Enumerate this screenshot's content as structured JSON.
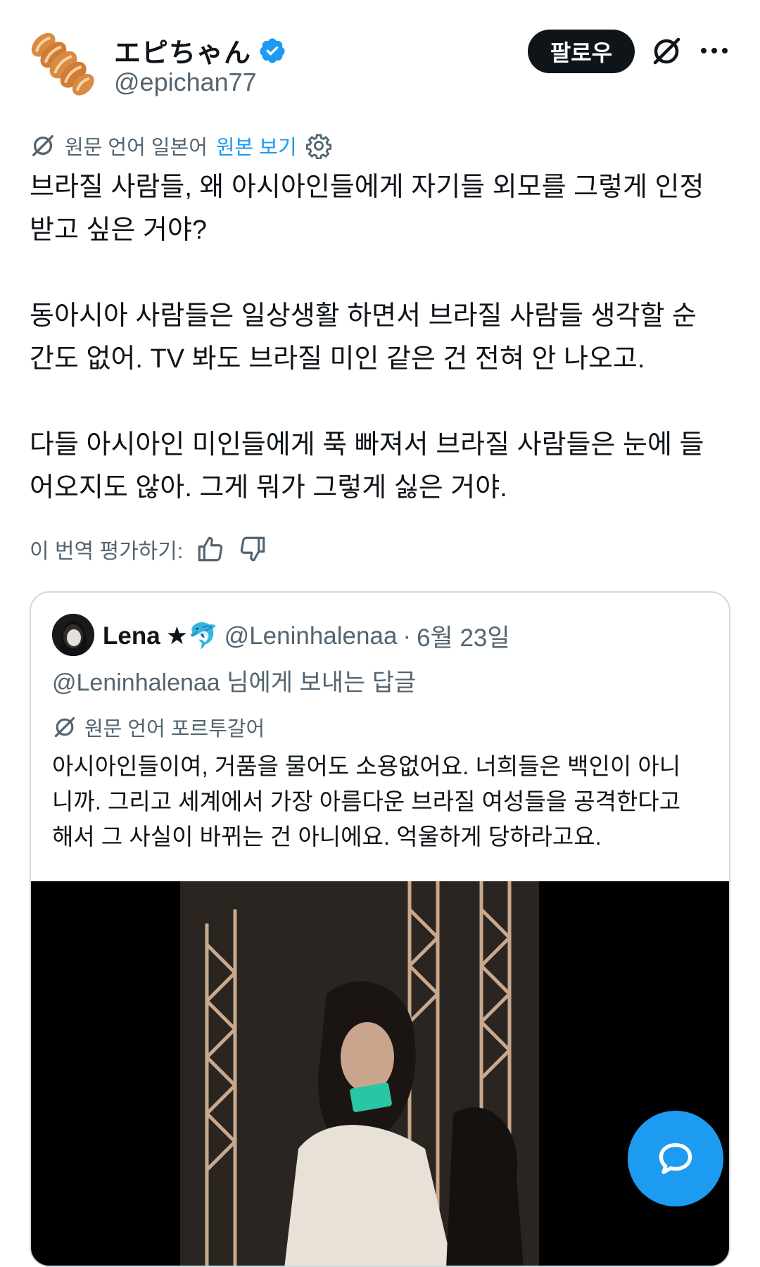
{
  "author": {
    "display_name": "エピちゃん",
    "handle": "@epichan77",
    "verified": true,
    "avatar_icon": "braided-bread-icon"
  },
  "actions": {
    "follow_label": "팔로우",
    "grok_icon": "grok-icon",
    "more_icon": "more-dots-icon"
  },
  "translation": {
    "source_language_text": "원문 언어 일본어",
    "show_original_label": "원본 보기",
    "settings_icon": "gear-icon"
  },
  "post": {
    "paragraphs": [
      "브라질 사람들, 왜 아시아인들에게 자기들 외모를 그렇게 인정\n받고 싶은 거야?",
      "동아시아 사람들은 일상생활 하면서 브라질 사람들 생각할 순\n간도 없어. TV 봐도 브라질 미인 같은 건 전혀 안 나오고.",
      "다들 아시아인 미인들에게 푹 빠져서 브라질 사람들은 눈에 들\n어오지도 않아. 그게 뭐가 그렇게 싫은 거야."
    ]
  },
  "rating": {
    "label": "이 번역 평가하기:",
    "up_icon": "thumbs-up-icon",
    "down_icon": "thumbs-down-icon"
  },
  "quote": {
    "display_name": "Lena",
    "badges": "★🐬",
    "handle": "@Leninhalenaa",
    "separator": "·",
    "date": "6월 23일",
    "reply_to": "@Leninhalenaa 님에게 보내는 답글",
    "translation_label": "원문 언어 포르투갈어",
    "text": "아시아인들이여, 거품을 물어도 소용없어요. 너희들은 백인이 아니\n니까. 그리고 세계에서 가장 아름다운 브라질 여성들을 공격한다고\n해서 그 사실이 바뀌는 건 아니에요. 억울하게 당하라고요."
  },
  "fab": {
    "icon": "compose-reply-icon"
  },
  "colors": {
    "accent": "#1d9bf0",
    "text": "#0f1419",
    "secondary": "#536471",
    "border": "#cfd9de"
  }
}
